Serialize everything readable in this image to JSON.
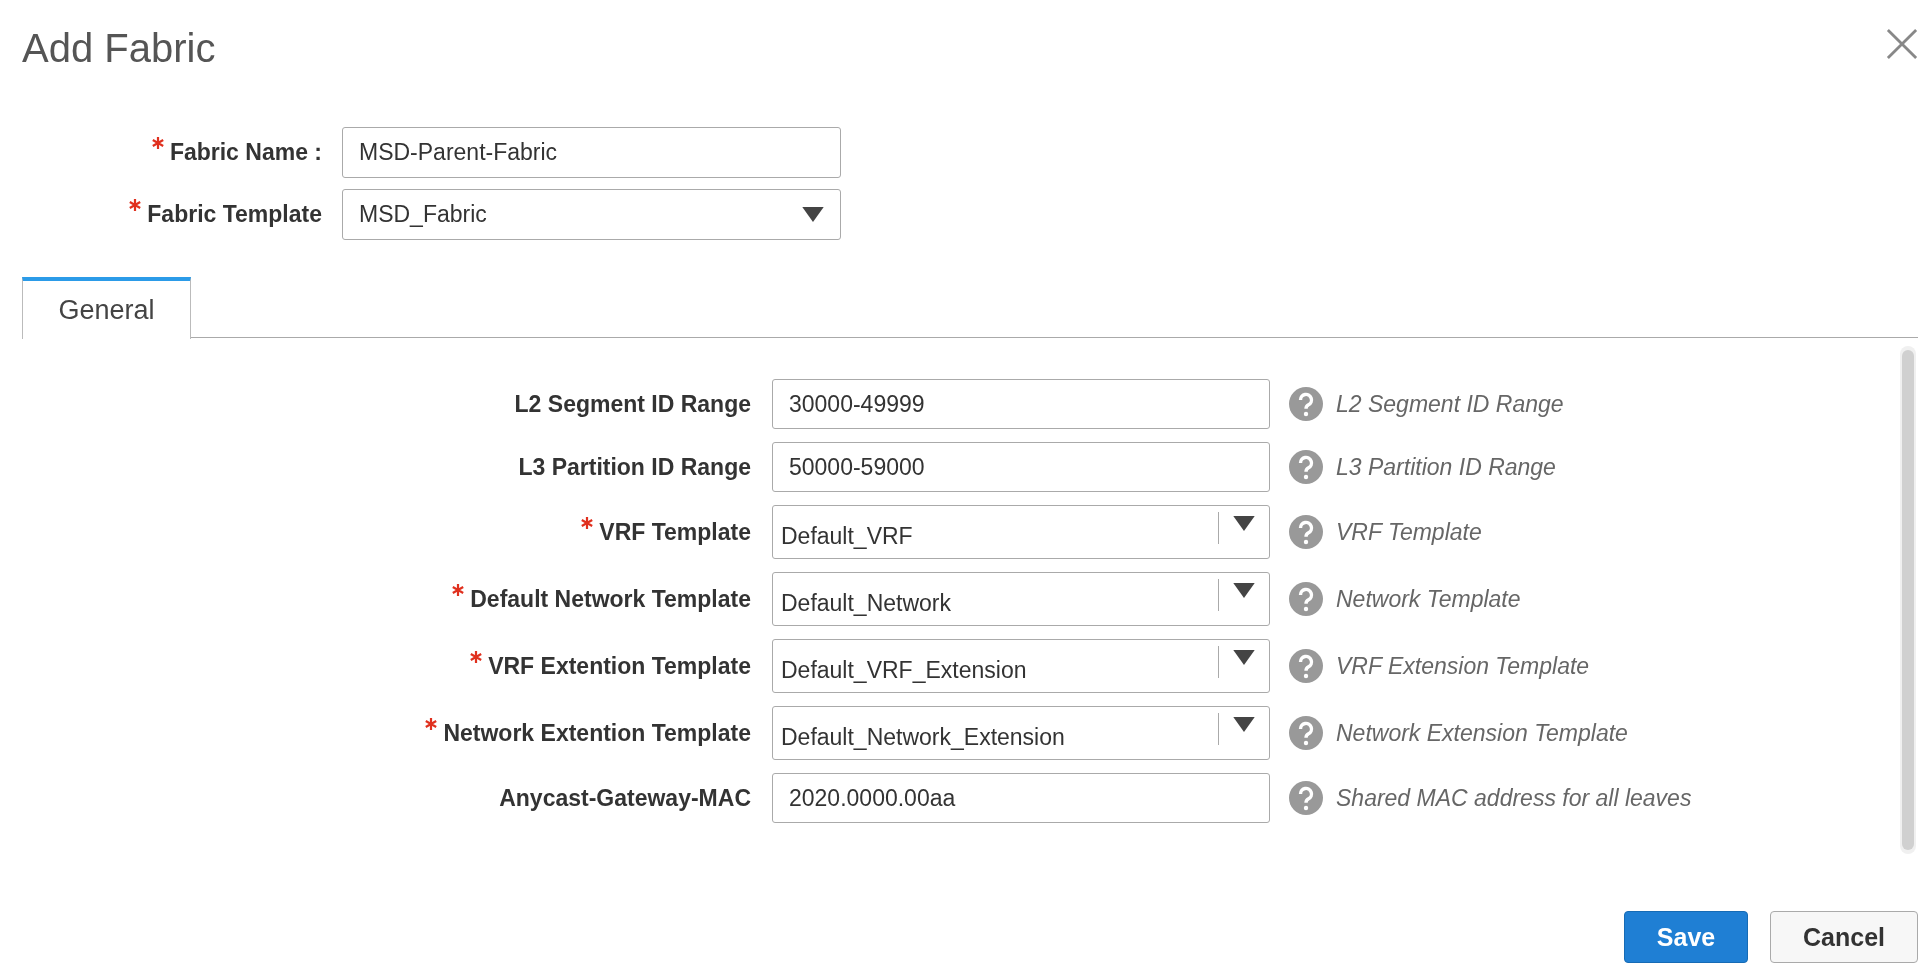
{
  "dialog": {
    "title": "Add Fabric"
  },
  "header_fields": [
    {
      "label": "Fabric Name :",
      "required": true,
      "kind": "text",
      "value": "MSD-Parent-Fabric"
    },
    {
      "label": "Fabric Template",
      "required": true,
      "kind": "select",
      "value": "MSD_Fabric"
    }
  ],
  "tabs": [
    {
      "label": "General",
      "selected": true
    }
  ],
  "fields": [
    {
      "label": "L2 Segment ID Range",
      "required": false,
      "kind": "text",
      "value": "30000-49999",
      "help": "L2 Segment ID Range"
    },
    {
      "label": "L3 Partition ID Range",
      "required": false,
      "kind": "text",
      "value": "50000-59000",
      "help": "L3 Partition ID Range"
    },
    {
      "label": "VRF Template",
      "required": true,
      "kind": "select",
      "value": "Default_VRF",
      "help": "VRF Template"
    },
    {
      "label": "Default Network Template",
      "required": true,
      "kind": "select",
      "value": "Default_Network",
      "help": "Network Template"
    },
    {
      "label": "VRF Extention Template",
      "required": true,
      "kind": "select",
      "value": "Default_VRF_Extension",
      "help": "VRF Extension Template"
    },
    {
      "label": "Network Extention Template",
      "required": true,
      "kind": "select",
      "value": "Default_Network_Extension",
      "help": "Network Extension Template"
    },
    {
      "label": "Anycast-Gateway-MAC",
      "required": false,
      "kind": "text",
      "value": "2020.0000.00aa",
      "help": "Shared MAC address for all leaves"
    }
  ],
  "buttons": [
    {
      "label": "Save",
      "kind": "primary"
    },
    {
      "label": "Cancel",
      "kind": "secondary"
    }
  ]
}
